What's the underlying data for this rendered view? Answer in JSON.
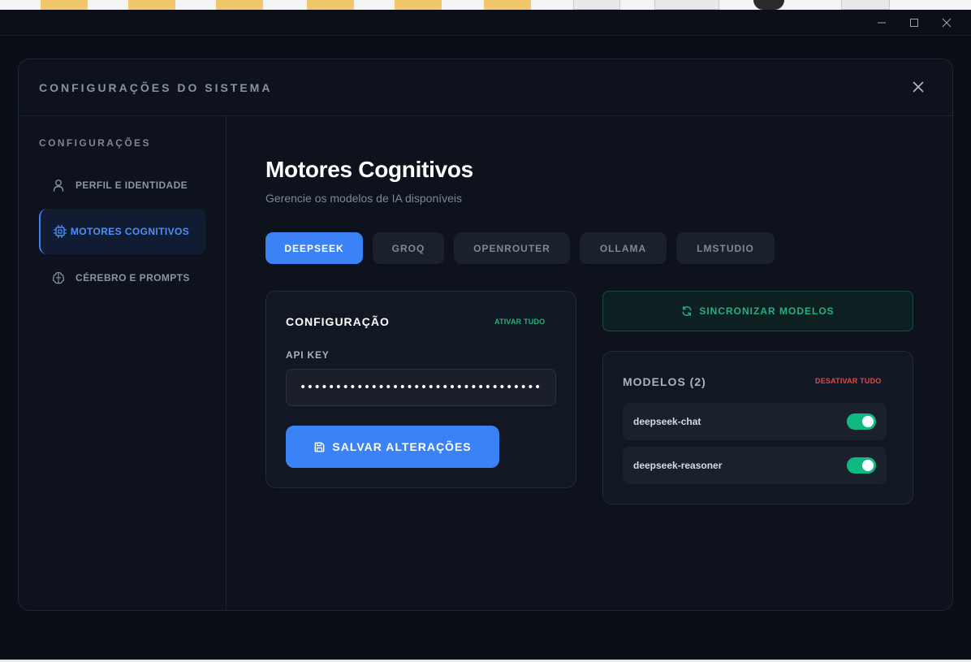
{
  "window": {
    "controls": [
      "minimize",
      "maximize",
      "close"
    ]
  },
  "modal": {
    "title": "CONFIGURAÇÕES DO SISTEMA"
  },
  "sidebar": {
    "heading": "CONFIGURAÇÕES",
    "items": [
      {
        "label": "PERFIL E IDENTIDADE",
        "icon": "user-icon",
        "active": false
      },
      {
        "label": "MOTORES COGNITIVOS",
        "icon": "cpu-icon",
        "active": true
      },
      {
        "label": "CÉREBRO E PROMPTS",
        "icon": "brain-icon",
        "active": false
      }
    ]
  },
  "main": {
    "title": "Motores Cognitivos",
    "subtitle": "Gerencie os modelos de IA disponíveis",
    "tabs": [
      {
        "label": "DEEPSEEK",
        "active": true
      },
      {
        "label": "GROQ",
        "active": false
      },
      {
        "label": "OPENROUTER",
        "active": false
      },
      {
        "label": "OLLAMA",
        "active": false
      },
      {
        "label": "LMSTUDIO",
        "active": false
      }
    ]
  },
  "config": {
    "title": "CONFIGURAÇÃO",
    "activate_all": "ATIVAR TUDO",
    "api_key_label": "API KEY",
    "api_key_value": "••••••••••••••••••••••••••••••••••",
    "save_label": "SALVAR ALTERAÇÕES"
  },
  "sync": {
    "label": "SINCRONIZAR MODELOS"
  },
  "models": {
    "title": "MODELOS (2)",
    "deactivate_all": "DESATIVAR TUDO",
    "items": [
      {
        "name": "deepseek-chat",
        "enabled": true
      },
      {
        "name": "deepseek-reasoner",
        "enabled": true
      }
    ]
  },
  "colors": {
    "accent": "#3b82f6",
    "success": "#10b981",
    "danger": "#e5484d",
    "background": "#0a0e17",
    "panel": "#111723"
  }
}
